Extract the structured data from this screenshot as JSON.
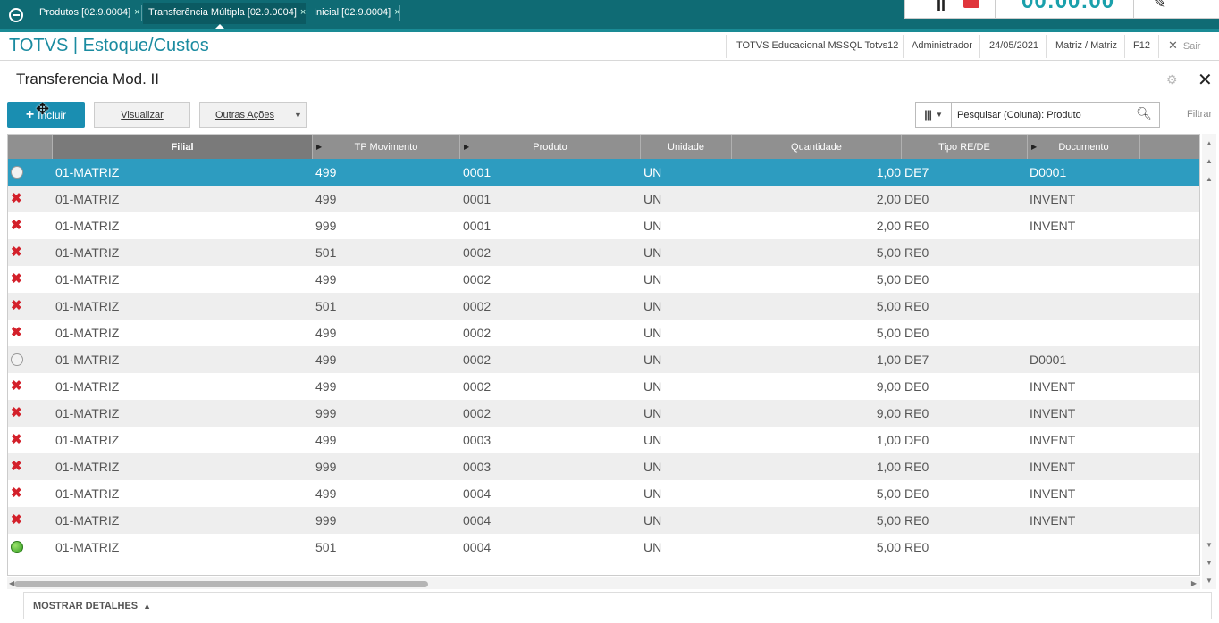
{
  "tabs": [
    {
      "label": "Produtos [02.9.0004]"
    },
    {
      "label": "Transferência Múltipla [02.9.0004]"
    },
    {
      "label": "Inicial [02.9.0004]"
    }
  ],
  "recorder": {
    "time": "00:00:00"
  },
  "header": {
    "app_title": "TOTVS | Estoque/Custos",
    "environment": "TOTVS Educacional MSSQL Totvs12",
    "user": "Administrador",
    "date": "24/05/2021",
    "branch": "Matriz / Matriz",
    "shortcut": "F12",
    "exit_label": "Sair"
  },
  "page": {
    "title": "Transferencia Mod. II"
  },
  "toolbar": {
    "include_label": "Incluir",
    "view_label": "Visualizar",
    "other_actions_label": "Outras Ações",
    "search_placeholder": "Pesquisar (Coluna): Produto",
    "filter_label": "Filtrar"
  },
  "grid": {
    "columns": [
      "Filial",
      "TP Movimento",
      "Produto",
      "Unidade",
      "Quantidade",
      "Tipo RE/DE",
      "Documento"
    ],
    "rows": [
      {
        "status": "white",
        "filial": "01-MATRIZ",
        "tp": "499",
        "produto": "0001",
        "unidade": "UN",
        "qtd": "1,00",
        "tipo": "DE7",
        "doc": "D0001"
      },
      {
        "status": "x",
        "filial": "01-MATRIZ",
        "tp": "499",
        "produto": "0001",
        "unidade": "UN",
        "qtd": "2,00",
        "tipo": "DE0",
        "doc": "INVENT"
      },
      {
        "status": "x",
        "filial": "01-MATRIZ",
        "tp": "999",
        "produto": "0001",
        "unidade": "UN",
        "qtd": "2,00",
        "tipo": "RE0",
        "doc": "INVENT"
      },
      {
        "status": "x",
        "filial": "01-MATRIZ",
        "tp": "501",
        "produto": "0002",
        "unidade": "UN",
        "qtd": "5,00",
        "tipo": "RE0",
        "doc": ""
      },
      {
        "status": "x",
        "filial": "01-MATRIZ",
        "tp": "499",
        "produto": "0002",
        "unidade": "UN",
        "qtd": "5,00",
        "tipo": "DE0",
        "doc": ""
      },
      {
        "status": "x",
        "filial": "01-MATRIZ",
        "tp": "501",
        "produto": "0002",
        "unidade": "UN",
        "qtd": "5,00",
        "tipo": "RE0",
        "doc": ""
      },
      {
        "status": "x",
        "filial": "01-MATRIZ",
        "tp": "499",
        "produto": "0002",
        "unidade": "UN",
        "qtd": "5,00",
        "tipo": "DE0",
        "doc": ""
      },
      {
        "status": "white",
        "filial": "01-MATRIZ",
        "tp": "499",
        "produto": "0002",
        "unidade": "UN",
        "qtd": "1,00",
        "tipo": "DE7",
        "doc": "D0001"
      },
      {
        "status": "x",
        "filial": "01-MATRIZ",
        "tp": "499",
        "produto": "0002",
        "unidade": "UN",
        "qtd": "9,00",
        "tipo": "DE0",
        "doc": "INVENT"
      },
      {
        "status": "x",
        "filial": "01-MATRIZ",
        "tp": "999",
        "produto": "0002",
        "unidade": "UN",
        "qtd": "9,00",
        "tipo": "RE0",
        "doc": "INVENT"
      },
      {
        "status": "x",
        "filial": "01-MATRIZ",
        "tp": "499",
        "produto": "0003",
        "unidade": "UN",
        "qtd": "1,00",
        "tipo": "DE0",
        "doc": "INVENT"
      },
      {
        "status": "x",
        "filial": "01-MATRIZ",
        "tp": "999",
        "produto": "0003",
        "unidade": "UN",
        "qtd": "1,00",
        "tipo": "RE0",
        "doc": "INVENT"
      },
      {
        "status": "x",
        "filial": "01-MATRIZ",
        "tp": "499",
        "produto": "0004",
        "unidade": "UN",
        "qtd": "5,00",
        "tipo": "DE0",
        "doc": "INVENT"
      },
      {
        "status": "x",
        "filial": "01-MATRIZ",
        "tp": "999",
        "produto": "0004",
        "unidade": "UN",
        "qtd": "5,00",
        "tipo": "RE0",
        "doc": "INVENT"
      },
      {
        "status": "green",
        "filial": "01-MATRIZ",
        "tp": "501",
        "produto": "0004",
        "unidade": "UN",
        "qtd": "5,00",
        "tipo": "RE0",
        "doc": ""
      }
    ]
  },
  "details": {
    "label": "MOSTRAR DETALHES"
  },
  "colors": {
    "brand": "#1a8ba0",
    "topbar": "#0f6b74",
    "selected_row": "#2d9cc0",
    "error": "#d3202a"
  }
}
